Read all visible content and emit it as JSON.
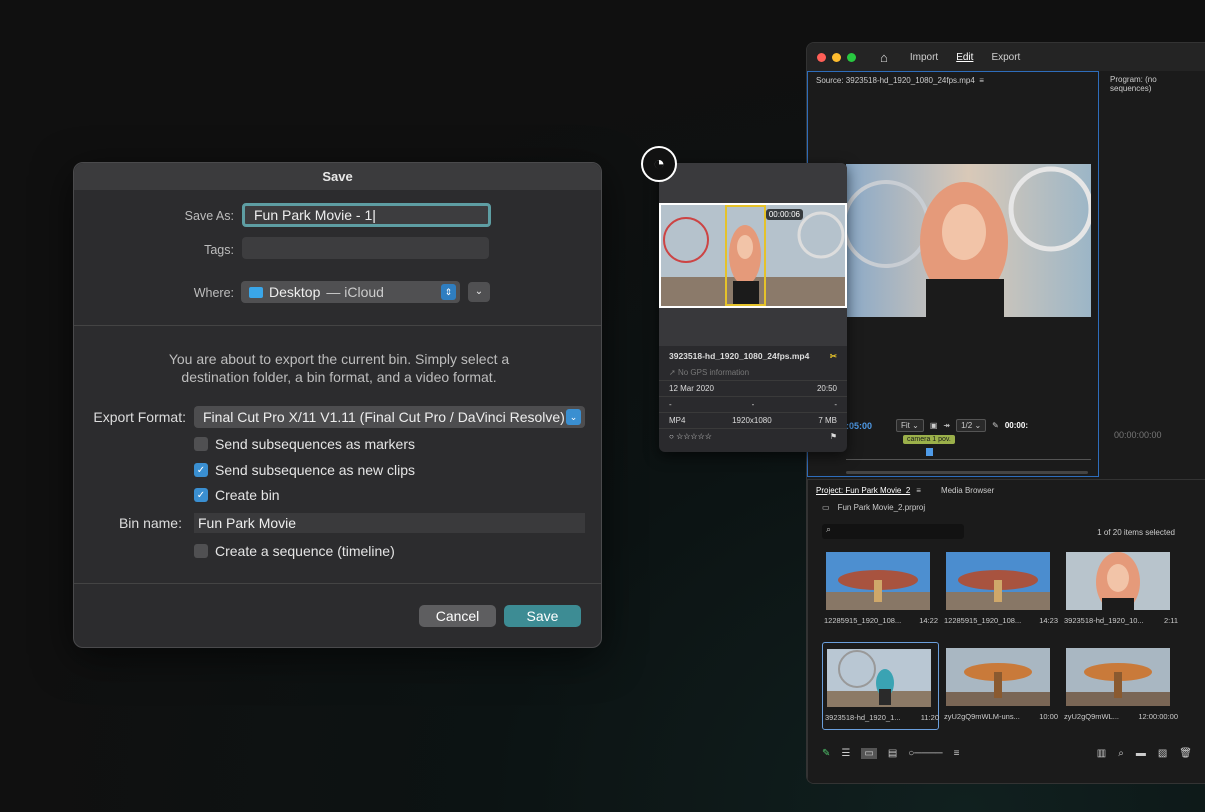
{
  "premiere": {
    "nav": {
      "home_icon": "⌂",
      "import": "Import",
      "edit": "Edit",
      "export": "Export"
    },
    "source": {
      "title": "Source: 3923518-hd_1920_1080_24fps.mp4",
      "menu_icon": "≡",
      "timecode": ":05:00",
      "fit": "Fit",
      "ratio": "1/2",
      "end_tc": "00:00:",
      "clip_label": "camera 1 pov."
    },
    "program": {
      "title": "Program: (no sequences)",
      "timecode": "00:00:00:00"
    },
    "project": {
      "tab_project": "Project: Fun Park Movie_2",
      "tab_menu": "≡",
      "tab_media": "Media Browser",
      "file": "Fun Park Movie_2.prproj",
      "count": "1 of 20 items selected",
      "tiles": [
        {
          "name": "12285915_1920_108...",
          "dur": "14:22"
        },
        {
          "name": "12285915_1920_108...",
          "dur": "14:23"
        },
        {
          "name": "3923518-hd_1920_10...",
          "dur": "2:11"
        },
        {
          "name": "3923518-hd_1920_1...",
          "dur": "11:20"
        },
        {
          "name": "zyU2gQ9mWLM-uns...",
          "dur": "10:00"
        },
        {
          "name": "zyU2gQ9mWL...",
          "dur": "12:00:00:00"
        }
      ]
    },
    "colors": {
      "accent": "#4f9be8"
    }
  },
  "preview": {
    "timecode": "00:00:06",
    "filename": "3923518-hd_1920_1080_24fps.mp4",
    "gps": "No GPS information",
    "date": "12 Mar 2020",
    "time": "20:50",
    "dash1": "-",
    "dash2": "-",
    "dash3": "-",
    "format": "MP4",
    "resolution": "1920x1080",
    "size": "7 MB",
    "rating": "☆☆☆☆☆"
  },
  "dialog": {
    "title": "Save",
    "save_as_label": "Save As:",
    "save_as_value": "Fun Park Movie - 1",
    "tags_label": "Tags:",
    "where_label": "Where:",
    "where_folder": "Desktop",
    "where_suffix": "— iCloud",
    "description": "You are about to export the current bin. Simply select a destination folder, a bin format, and a video format.",
    "export_format_label": "Export Format:",
    "export_format_value": "Final Cut Pro X/11 V1.11 (Final Cut Pro / DaVinci Resolve)",
    "options": [
      {
        "label": "Send subsequences as markers",
        "checked": false
      },
      {
        "label": "Send subsequence as new clips",
        "checked": true
      },
      {
        "label": "Create bin",
        "checked": true
      }
    ],
    "bin_name_label": "Bin name:",
    "bin_name_value": "Fun Park Movie",
    "sequence_option": {
      "label": "Create a sequence (timeline)",
      "checked": false
    },
    "cancel": "Cancel",
    "save": "Save"
  }
}
